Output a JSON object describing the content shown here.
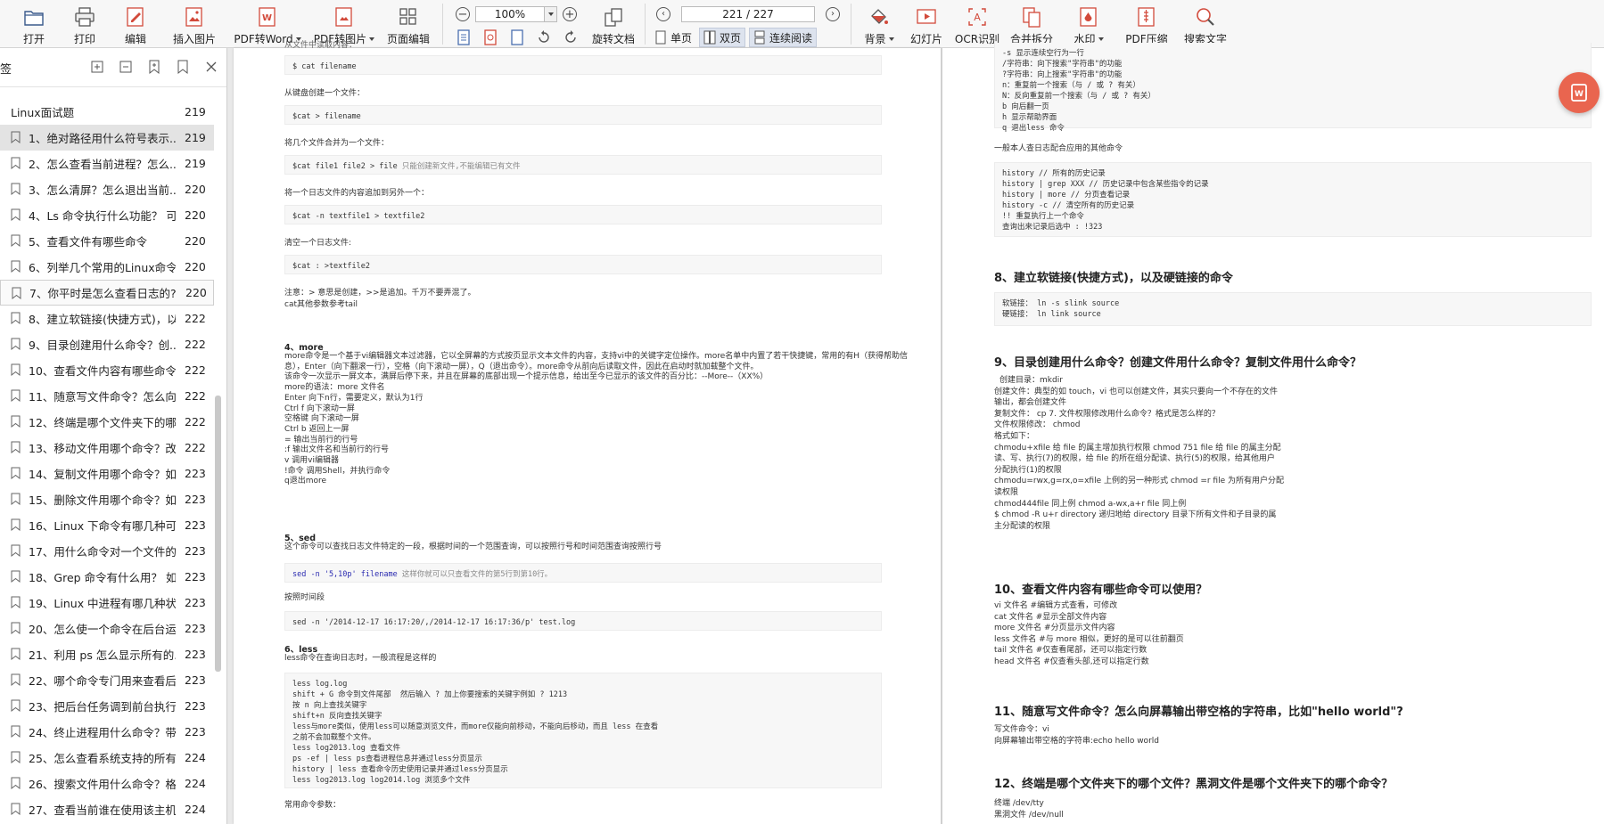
{
  "toolbar": {
    "open": "打开",
    "print": "打印",
    "edit": "编辑",
    "insert_image": "插入图片",
    "pdf_to_word": "PDF转Word",
    "pdf_to_image": "PDF转图片",
    "page_edit": "页面编辑",
    "zoom": "100%",
    "page": "221 / 227",
    "rotate": "旋转文档",
    "single": "单页",
    "double": "双页",
    "continuous": "连续阅读",
    "background": "背景",
    "slideshow": "幻灯片",
    "ocr": "OCR识别",
    "merge_split": "合并拆分",
    "watermark": "水印",
    "compress": "PDF压缩",
    "search_text": "搜索文字"
  },
  "sidebar": {
    "title": "签",
    "root": {
      "label": "Linux面试题",
      "page": "219"
    },
    "items": [
      {
        "label": "1、绝对路径用什么符号表示...",
        "page": "219"
      },
      {
        "label": "2、怎么查看当前进程？怎么...",
        "page": "219"
      },
      {
        "label": "3、怎么清屏？怎么退出当前...",
        "page": "220"
      },
      {
        "label": "4、Ls 命令执行什么功能？ 可...",
        "page": "220"
      },
      {
        "label": "5、查看文件有哪些命令",
        "page": "220"
      },
      {
        "label": "6、列举几个常用的Linux命令",
        "page": "220"
      },
      {
        "label": "7、你平时是怎么查看日志的?",
        "page": "220"
      },
      {
        "label": "8、建立软链接(快捷方式)，以...",
        "page": "222"
      },
      {
        "label": "9、目录创建用什么命令？创...",
        "page": "222"
      },
      {
        "label": "10、查看文件内容有哪些命令...",
        "page": "222"
      },
      {
        "label": "11、随意写文件命令？怎么向...",
        "page": "222"
      },
      {
        "label": "12、终端是哪个文件夹下的哪...",
        "page": "222"
      },
      {
        "label": "13、移动文件用哪个命令？改...",
        "page": "222"
      },
      {
        "label": "14、复制文件用哪个命令？如...",
        "page": "223"
      },
      {
        "label": "15、删除文件用哪个命令？如...",
        "page": "223"
      },
      {
        "label": "16、Linux 下命令有哪几种可...",
        "page": "223"
      },
      {
        "label": "17、用什么命令对一个文件的...",
        "page": "223"
      },
      {
        "label": "18、Grep 命令有什么用？ 如...",
        "page": "223"
      },
      {
        "label": "19、Linux 中进程有哪几种状...",
        "page": "223"
      },
      {
        "label": "20、怎么使一个命令在后台运...",
        "page": "223"
      },
      {
        "label": "21、利用 ps 怎么显示所有的...",
        "page": "223"
      },
      {
        "label": "22、哪个命令专门用来查看后...",
        "page": "223"
      },
      {
        "label": "23、把后台任务调到前台执行...",
        "page": "223"
      },
      {
        "label": "24、终止进程用什么命令？带...",
        "page": "223"
      },
      {
        "label": "25、怎么查看系统支持的所有...",
        "page": "224"
      },
      {
        "label": "26、搜索文件用什么命令？格...",
        "page": "224"
      },
      {
        "label": "27、查看当前谁在使用该主机...",
        "page": "224"
      }
    ]
  },
  "left_page": {
    "top_cut": "从文件中读取内容：",
    "c1": "$ cat filename",
    "t1": "从键盘创建一个文件：",
    "c2": "$cat > filename",
    "t2": "将几个文件合并为一个文件：",
    "c3a": "$cat file1 file2 > file ",
    "c3b": "只能创建新文件,不能编辑已有文件",
    "t3": "将一个日志文件的内容追加到另外一个：",
    "c4": "$cat -n textfile1 > textfile2",
    "t4": "清空一个日志文件:",
    "c5": "$cat : >textfile2",
    "t5a": "注意：> 意思是创建，>>是追加。千万不要弄混了。",
    "t5b": "cat其他参数参考tail",
    "h4": "4、more",
    "more": [
      "more命令是一个基于vi编辑器文本过滤器，它以全屏幕的方式按页显示文本文件的内容，支持vi中的关键字定位操作。more名单中内置了若干快捷键，常用的有H（获得帮助信",
      "息），Enter（向下翻滚一行），空格（向下滚动一屏），Q（退出命令）。more命令从前向后读取文件，因此在启动时就加载整个文件。",
      "该命令一次显示一屏文本，满屏后停下来，并且在屏幕的底部出现一个提示信息，给出至今已显示的该文件的百分比：--More--（XX%）",
      "more的语法：more 文件名",
      "Enter 向下n行，需要定义，默认为1行",
      "Ctrl f 向下滚动一屏",
      "空格键 向下滚动一屏",
      "Ctrl b 返回上一屏",
      "= 输出当前行的行号",
      ":f 输出文件名和当前行的行号",
      "v 调用vi编辑器",
      "!命令 调用Shell，并执行命令",
      "q退出more"
    ],
    "h5": "5、sed",
    "sed_desc": "这个命令可以查找日志文件特定的一段，根据时间的一个范围查询，可以按照行号和时间范围查询按照行号",
    "c6a": "sed -n '5,10p' filename ",
    "c6b": "这样你就可以只查看文件的第5行到第10行。",
    "t6": "按照时间段",
    "c7": "sed -n '/2014-12-17 16:17:20/,/2014-12-17 16:17:36/p' test.log",
    "h6": "6、less",
    "less_desc": "less命令在查询日志时，一般流程是这样的",
    "less_code": [
      "less log.log",
      "shift + G 命令到文件尾部  然后输入 ? 加上你要搜索的关键字例如 ? 1213",
      "按 n 向上查找关键字",
      "shift+n 反向查找关键字",
      "less与more类似，使用less可以随意浏览文件，而more仅能向前移动，不能向后移动，而且 less 在查看",
      "之前不会加载整个文件。",
      "less log2013.log 查看文件",
      "ps -ef | less ps查看进程信息并通过less分页显示",
      "history | less 查看命令历史使用记录并通过less分页显示",
      "less log2013.log log2014.log 浏览多个文件"
    ],
    "bottom": "常用命令参数："
  },
  "right_page": {
    "top_code": [
      "-s 显示连续空行为一行",
      "/字符串：向下搜索\"字符串\"的功能",
      "?字符串：向上搜索\"字符串\"的功能",
      "n：重复前一个搜索（与 / 或 ? 有关）",
      "N：反向重复前一个搜索（与 / 或 ? 有关）",
      "b 向后翻一页",
      "h 显示帮助界面",
      "q 退出less 命令"
    ],
    "t1": "一般本人查日志配合应用的其他命令",
    "hist_code": [
      "history // 所有的历史记录",
      "history | grep XXX // 历史记录中包含某些指令的记录",
      "history | more // 分页查看记录",
      "history -c // 清空所有的历史记录",
      "!! 重复执行上一个命令",
      "查询出来记录后选中 : !323"
    ],
    "h8": "8、建立软链接(快捷方式)，以及硬链接的命令",
    "link_code": [
      "软链接： ln -s slink source",
      "硬链接： ln link source"
    ],
    "h9": "9、目录创建用什么命令？创建文件用什么命令？复制文件用什么命令？",
    "q9": [
      "创建目录：mkdir",
      "创建文件：典型的如 touch，vi 也可以创建文件，其实只要向一个不存在的文件",
      "输出，都会创建文件",
      "复制文件： cp 7. 文件权限修改用什么命令？格式是怎么样的？",
      "文件权限修改： chmod",
      "格式如下：",
      "chmodu+xfile 给 file 的属主增加执行权限 chmod 751 file 给 file 的属主分配",
      "读、写、执行(7)的权限，给 file 的所在组分配读、执行(5)的权限，给其他用户",
      "分配执行(1)的权限",
      "chmodu=rwx,g=rx,o=xfile 上例的另一种形式 chmod =r file 为所有用户分配",
      "读权限",
      "chmod444file 同上例 chmod a-wx,a+r file 同上例",
      "$ chmod -R u+r directory 递归地给 directory 目录下所有文件和子目录的属",
      "主分配读的权限"
    ],
    "h10": "10、查看文件内容有哪些命令可以使用？",
    "q10": [
      "vi 文件名 #编辑方式查看，可修改",
      "cat 文件名 #显示全部文件内容",
      "more 文件名 #分页显示文件内容",
      "less 文件名 #与 more 相似，更好的是可以往前翻页",
      "tail 文件名 #仅查看尾部，还可以指定行数",
      "head 文件名 #仅查看头部,还可以指定行数"
    ],
    "h11": "11、随意写文件命令？怎么向屏幕输出带空格的字符串，比如\"hello world\"?",
    "q11": [
      "写文件命令：vi",
      "向屏幕输出带空格的字符串:echo hello world"
    ],
    "h12": "12、终端是哪个文件夹下的哪个文件？黑洞文件是哪个文件夹下的哪个命令？",
    "q12": [
      "终端 /dev/tty",
      "黑洞文件 /dev/null"
    ]
  }
}
